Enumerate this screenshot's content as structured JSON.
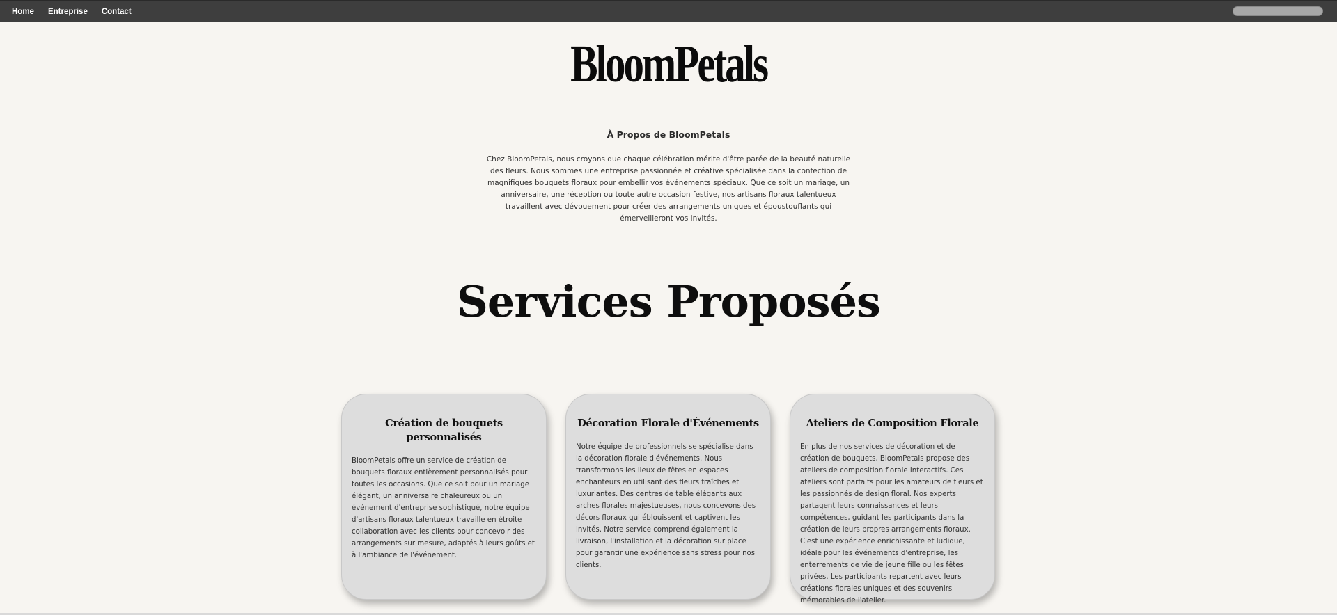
{
  "nav": {
    "items": [
      {
        "label": "Home"
      },
      {
        "label": "Entreprise"
      },
      {
        "label": "Contact"
      }
    ],
    "search": {
      "value": "",
      "placeholder": ""
    }
  },
  "logo": {
    "text": "BloomPetals"
  },
  "about": {
    "title": "À Propos de BloomPetals",
    "text": "Chez BloomPetals, nous croyons que chaque célébration mérite d'être parée de la beauté naturelle des fleurs. Nous sommes une entreprise passionnée et créative spécialisée dans la confection de magnifiques bouquets floraux pour embellir vos événements spéciaux. Que ce soit un mariage, un anniversaire, une réception ou toute autre occasion festive, nos artisans floraux talentueux travaillent avec dévouement pour créer des arrangements uniques et époustouflants qui émerveilleront vos invités."
  },
  "services": {
    "title": "Services Proposés",
    "cards": [
      {
        "title": "Création de bouquets personnalisés",
        "text": "BloomPetals offre un service de création de bouquets floraux entièrement personnalisés pour toutes les occasions. Que ce soit pour un mariage élégant, un anniversaire chaleureux ou un événement d'entreprise sophistiqué, notre équipe d'artisans floraux talentueux travaille en étroite collaboration avec les clients pour concevoir des arrangements sur mesure, adaptés à leurs goûts et à l'ambiance de l'événement."
      },
      {
        "title": "Décoration Florale d'Événements",
        "text": "Notre équipe de professionnels se spécialise dans la décoration florale d'événements. Nous transformons les lieux de fêtes en espaces enchanteurs en utilisant des fleurs fraîches et luxuriantes. Des centres de table élégants aux arches florales majestueuses, nous concevons des décors floraux qui éblouissent et captivent les invités. Notre service comprend également la livraison, l'installation et la décoration sur place pour garantir une expérience sans stress pour nos clients."
      },
      {
        "title": "Ateliers de Composition Florale",
        "text": "En plus de nos services de décoration et de création de bouquets, BloomPetals propose des ateliers de composition florale interactifs. Ces ateliers sont parfaits pour les amateurs de fleurs et les passionnés de design floral. Nos experts partagent leurs connaissances et leurs compétences, guidant les participants dans la création de leurs propres arrangements floraux. C'est une expérience enrichissante et ludique, idéale pour les événements d'entreprise, les enterrements de vie de jeune fille ou les fêtes privées. Les participants repartent avec leurs créations florales uniques et des souvenirs mémorables de l'atelier."
      }
    ]
  }
}
